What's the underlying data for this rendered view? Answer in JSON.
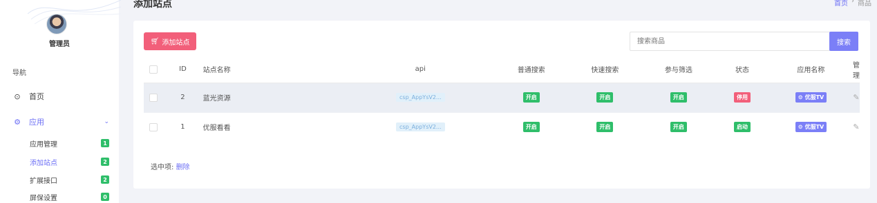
{
  "sidebar": {
    "admin_name": "管理员",
    "nav_heading": "导航",
    "home_label": "首页",
    "apps_label": "应用",
    "sub_items": [
      {
        "label": "应用管理",
        "badge": "1"
      },
      {
        "label": "添加站点",
        "badge": "2"
      },
      {
        "label": "扩展接口",
        "badge": "2"
      },
      {
        "label": "屏保设置",
        "badge": "0"
      }
    ],
    "accent": "#6c6ff5"
  },
  "header": {
    "title": "添加站点",
    "breadcrumb_home": "首页",
    "breadcrumb_sep": "›",
    "breadcrumb_current": "商品"
  },
  "toolbar": {
    "add_label": "添加站点",
    "search_placeholder": "搜索商品",
    "search_button": "搜索"
  },
  "table": {
    "columns": [
      "ID",
      "站点名称",
      "api",
      "普通搜索",
      "快速搜索",
      "参与筛选",
      "状态",
      "应用名称",
      "管理"
    ],
    "rows": [
      {
        "id": "2",
        "name": "蓝光资源",
        "api": "csp_AppYsV2...",
        "normal": "开启",
        "quick": "开启",
        "filter": "开启",
        "status": "停用",
        "app": "⚙ 优服TV"
      },
      {
        "id": "1",
        "name": "优服看看",
        "api": "csp_AppYsV2...",
        "normal": "开启",
        "quick": "开启",
        "filter": "开启",
        "status": "启动",
        "app": "⚙ 优服TV"
      }
    ]
  },
  "footer": {
    "selected_label": "选中项:",
    "delete_label": "删除"
  },
  "colors": {
    "primary": "#7b7ff7",
    "danger": "#f25f7a",
    "success": "#2fbe6a"
  }
}
